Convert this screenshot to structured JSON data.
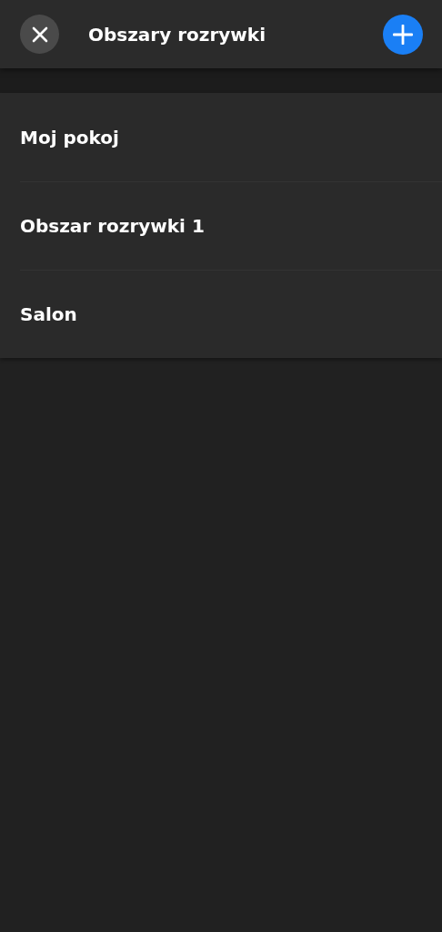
{
  "header": {
    "title": "Obszary rozrywki"
  },
  "areas": [
    {
      "name": "Moj pokoj"
    },
    {
      "name": "Obszar rozrywki 1"
    },
    {
      "name": "Salon"
    }
  ]
}
